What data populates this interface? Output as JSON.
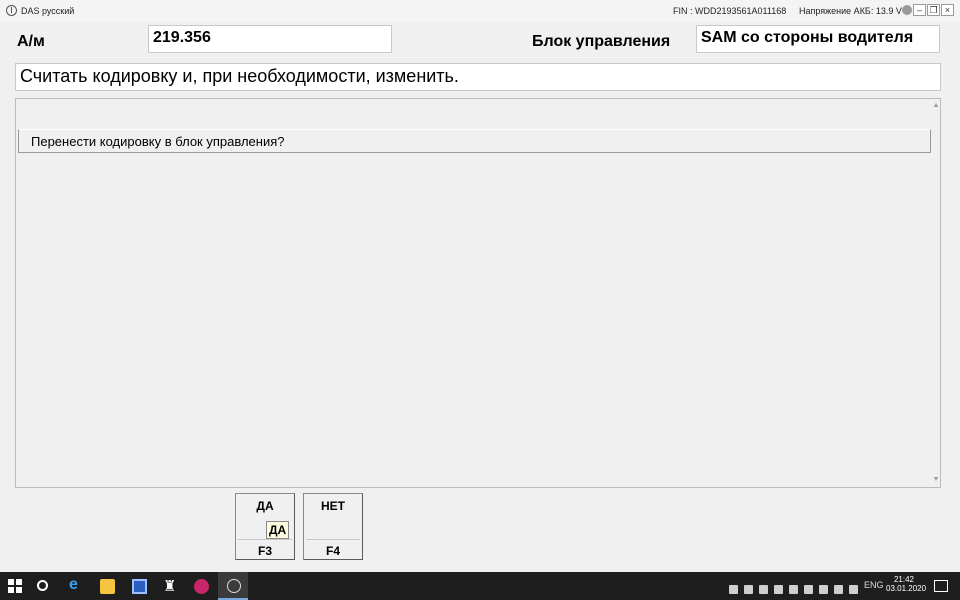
{
  "titlebar": {
    "title": "DAS русский",
    "fin": "FIN : WDD2193561A011168",
    "voltage": "Напряжение АКБ: 13.9 V",
    "minimize": "–",
    "maximize": "❐",
    "close": "×"
  },
  "header": {
    "vehicle_label": "А/м",
    "vehicle_value": "219.356",
    "control_unit_label": "Блок управления",
    "control_unit_value": "SAM со стороны водителя"
  },
  "instruction": "Считать кодировку и, при необходимости, изменить.",
  "question": "Перенести кодировку в блок управления?",
  "buttons": {
    "yes": {
      "label": "ДА",
      "key": "F3",
      "tooltip": "ДА"
    },
    "no": {
      "label": "НЕТ",
      "key": "F4"
    }
  },
  "taskbar": {
    "lang": "ENG",
    "time": "21:42",
    "date": "03.01.2020",
    "notifications": "1"
  },
  "icons": {
    "app": "mercedes-star-icon",
    "start": "windows-start-icon",
    "search": "search-icon",
    "edge": "edge-browser-icon",
    "explorer": "folder-icon",
    "save": "floppy-disk-icon",
    "chess": "chess-piece-icon",
    "app1": "app-icon",
    "das": "mercedes-star-icon"
  }
}
